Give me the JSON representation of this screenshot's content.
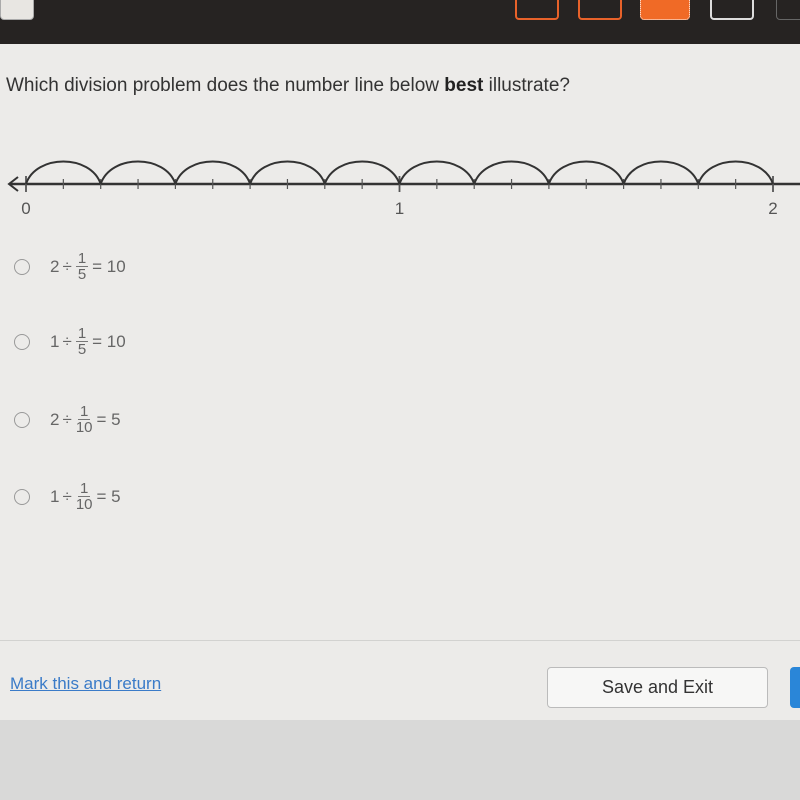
{
  "question": {
    "prefix": "Which division problem does the number line below ",
    "bold": "best",
    "suffix": " illustrate?"
  },
  "number_line": {
    "min": 0,
    "max": 2,
    "labels": [
      "0",
      "1",
      "2"
    ],
    "jump_size": 0.2,
    "jump_count": 10,
    "tick_step": 0.1
  },
  "choices": [
    {
      "whole": "2",
      "op": "÷",
      "num": "1",
      "den": "5",
      "eq": "= 10"
    },
    {
      "whole": "1",
      "op": "÷",
      "num": "1",
      "den": "5",
      "eq": "= 10"
    },
    {
      "whole": "2",
      "op": "÷",
      "num": "1",
      "den": "10",
      "eq": "= 5"
    },
    {
      "whole": "1",
      "op": "÷",
      "num": "1",
      "den": "10",
      "eq": "= 5"
    }
  ],
  "footer": {
    "mark_link": "Mark this and return",
    "save_exit": "Save and Exit"
  },
  "colors": {
    "topbar": "#262322",
    "accent_orange": "#f06a26",
    "link": "#3a7bc8",
    "next_button": "#2a86d8"
  }
}
